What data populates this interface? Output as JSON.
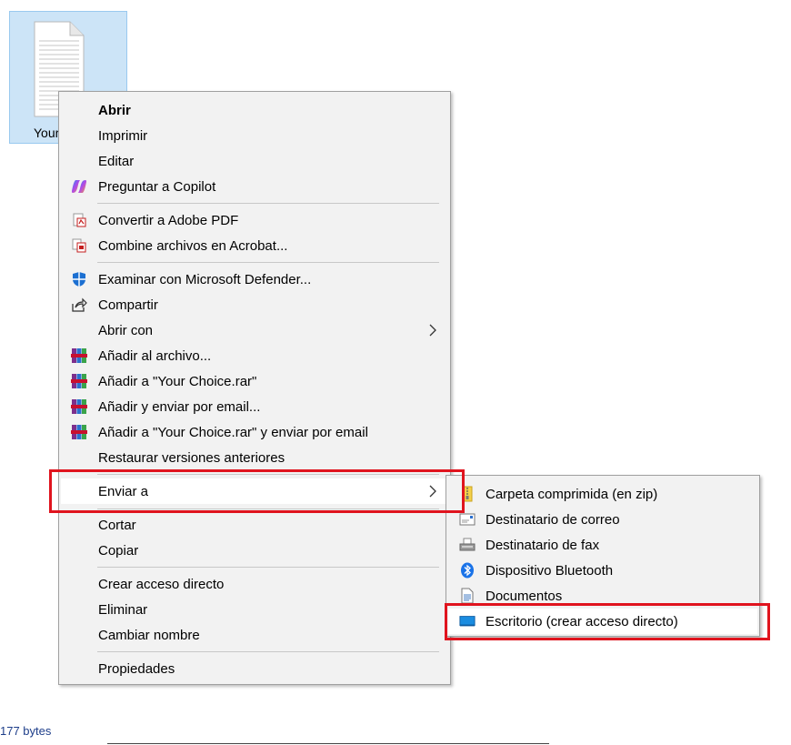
{
  "desktop": {
    "file_label": "Your",
    "status": "177 bytes"
  },
  "context_menu": {
    "items": [
      {
        "label": "Abrir"
      },
      {
        "label": "Imprimir"
      },
      {
        "label": "Editar"
      },
      {
        "label": "Preguntar a Copilot",
        "icon": "copilot-icon"
      },
      {
        "label": "Convertir a Adobe PDF",
        "icon": "adobe-pdf-icon"
      },
      {
        "label": "Combine archivos en Acrobat...",
        "icon": "acrobat-combine-icon"
      },
      {
        "label": "Examinar con Microsoft Defender...",
        "icon": "defender-shield-icon"
      },
      {
        "label": "Compartir",
        "icon": "share-icon"
      },
      {
        "label": "Abrir con",
        "submenu": true
      },
      {
        "label": "Añadir al archivo...",
        "icon": "winrar-icon"
      },
      {
        "label": "Añadir a \"Your Choice.rar\"",
        "icon": "winrar-icon"
      },
      {
        "label": "Añadir y enviar por email...",
        "icon": "winrar-icon"
      },
      {
        "label": "Añadir a \"Your Choice.rar\" y enviar por email",
        "icon": "winrar-icon"
      },
      {
        "label": "Restaurar versiones anteriores"
      },
      {
        "label": "Enviar a",
        "submenu": true,
        "highlighted": true
      },
      {
        "label": "Cortar"
      },
      {
        "label": "Copiar"
      },
      {
        "label": "Crear acceso directo"
      },
      {
        "label": "Eliminar"
      },
      {
        "label": "Cambiar nombre"
      },
      {
        "label": "Propiedades"
      }
    ]
  },
  "send_to_menu": {
    "items": [
      {
        "label": "Carpeta comprimida (en zip)",
        "icon": "zip-folder-icon"
      },
      {
        "label": "Destinatario de correo",
        "icon": "mail-recipient-icon"
      },
      {
        "label": "Destinatario de fax",
        "icon": "fax-icon"
      },
      {
        "label": "Dispositivo Bluetooth",
        "icon": "bluetooth-icon"
      },
      {
        "label": "Documentos",
        "icon": "documents-icon"
      },
      {
        "label": "Escritorio (crear acceso directo)",
        "icon": "desktop-icon",
        "highlighted": true
      }
    ]
  },
  "colors": {
    "highlight_box": "#e0141e",
    "menu_background": "#f2f2f2",
    "selection_tile": "#cce4f7"
  }
}
